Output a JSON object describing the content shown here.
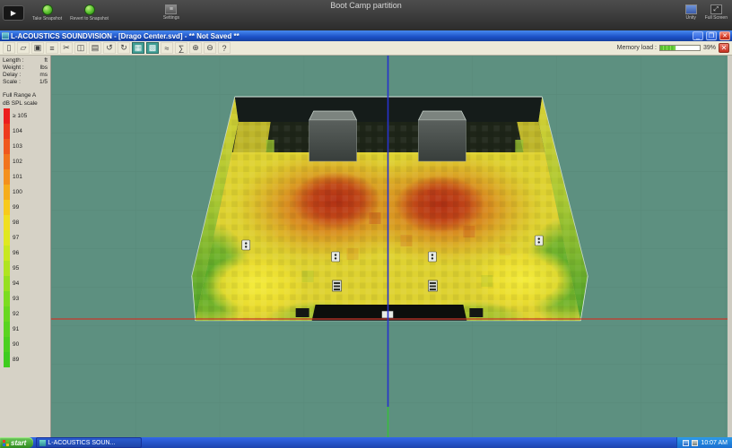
{
  "vm": {
    "title": "Boot Camp partition",
    "buttons": {
      "take_snapshot": "Take Snapshot",
      "revert_snapshot": "Revert to Snapshot",
      "settings": "Settings",
      "unity": "Unity",
      "full_screen": "Full Screen"
    }
  },
  "window": {
    "title": "L-ACOUSTICS SOUNDVISION - [Drago Center.svd] - ** Not Saved **"
  },
  "toolbar": {
    "memory_label": "Memory load :",
    "memory_value": "39%",
    "memory_pct": 39,
    "icons": [
      {
        "name": "new-file-icon",
        "glyph": "▯"
      },
      {
        "name": "open-file-icon",
        "glyph": "▱"
      },
      {
        "name": "save-icon",
        "glyph": "▣"
      },
      {
        "name": "print-icon",
        "glyph": "≡"
      },
      {
        "name": "cut-icon",
        "glyph": "✂"
      },
      {
        "name": "copy-icon",
        "glyph": "◫"
      },
      {
        "name": "paste-icon",
        "glyph": "▤"
      },
      {
        "name": "undo-icon",
        "glyph": "↺"
      },
      {
        "name": "redo-icon",
        "glyph": "↻"
      },
      {
        "name": "mapping-view-icon",
        "glyph": "▦",
        "bg": "#3f9d93"
      },
      {
        "name": "room-view-icon",
        "glyph": "▩",
        "bg": "#3f9d93"
      },
      {
        "name": "chart-icon",
        "glyph": "≈"
      },
      {
        "name": "sum-icon",
        "glyph": "∑"
      },
      {
        "name": "zoom-in-icon",
        "glyph": "⊕"
      },
      {
        "name": "zoom-out-icon",
        "glyph": "⊖"
      },
      {
        "name": "help-icon",
        "glyph": "?"
      }
    ]
  },
  "panel": {
    "info": [
      {
        "label": "Length :",
        "value": "ft"
      },
      {
        "label": "Weight :",
        "value": "lbs"
      },
      {
        "label": "Delay :",
        "value": "ms"
      },
      {
        "label": "Scale :",
        "value": "1/5"
      }
    ],
    "preset": "Full Range A",
    "scale_title": "dB SPL scale",
    "scale": [
      {
        "label": "≥ 105",
        "color": "#ec1d1d"
      },
      {
        "label": "104",
        "color": "#ee3a1c"
      },
      {
        "label": "103",
        "color": "#f0571c"
      },
      {
        "label": "102",
        "color": "#f2741c"
      },
      {
        "label": "101",
        "color": "#f4901c"
      },
      {
        "label": "100",
        "color": "#f6ad1b"
      },
      {
        "label": "99",
        "color": "#f8ca1b"
      },
      {
        "label": "98",
        "color": "#f0df20"
      },
      {
        "label": "97",
        "color": "#dfe81e"
      },
      {
        "label": "96",
        "color": "#c8e81e"
      },
      {
        "label": "95",
        "color": "#b0e41e"
      },
      {
        "label": "94",
        "color": "#96e01e"
      },
      {
        "label": "93",
        "color": "#7cdc1e"
      },
      {
        "label": "92",
        "color": "#69d81e"
      },
      {
        "label": "91",
        "color": "#5ad41e"
      },
      {
        "label": "90",
        "color": "#4bd01e"
      },
      {
        "label": "89",
        "color": "#3ecc1e"
      }
    ]
  },
  "viewport": {
    "axis_colors": {
      "x_axis": "#c8372a",
      "center_line": "#2733cc",
      "front_line": "#39bc3e"
    },
    "background": "#5d9080"
  },
  "taskbar": {
    "start": "start",
    "task": "L-ACOUSTICS SOUN...",
    "time": "10:07 AM"
  }
}
